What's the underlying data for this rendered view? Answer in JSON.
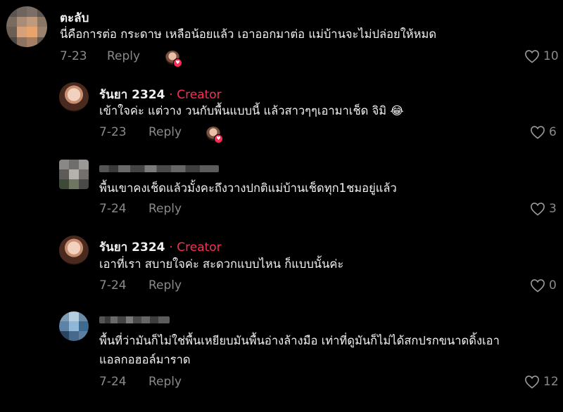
{
  "comments": [
    {
      "username": "ตะลับ",
      "text": "นี่คือการต่อ กระดาษ เหลือน้อยแล้ว เอาออกมาต่อ แม่บ้านจะไม่ปล่อยให้หมด",
      "date": "7-23",
      "reply_label": "Reply",
      "likes": "10",
      "creator_liked": true
    },
    {
      "username": "รันยา 2324",
      "creator_label": "· Creator",
      "text": "เข้าใจค่ะ แต่วาง วนกับพื้นแบบนี้ แล้วสาวๆๆเอามาเช็ด จิมิ 😂",
      "date": "7-23",
      "reply_label": "Reply",
      "likes": "6",
      "creator_liked": true
    },
    {
      "text": "พื้นเขาคงเช็ดแล้วมั้งคะถึงวางปกติแม่บ้านเช็ดทุก1ชมอยู่แล้ว",
      "date": "7-24",
      "reply_label": "Reply",
      "likes": "3"
    },
    {
      "username": "รันยา 2324",
      "creator_label": "· Creator",
      "text": "เอาที่เรา สบายใจค่ะ สะดวกแบบไหน ก็แบบนั้นค่ะ",
      "date": "7-24",
      "reply_label": "Reply",
      "likes": "0"
    },
    {
      "text_line1": "พื้นที่ว่ามันก็ไม่ใช่พื้นเหยียบมันพื้นอ่างล้างมือ เท่าที่ดูมันก็ไม่ได้สกปรกขนาดดิ้งเอา",
      "text_line2": "แอลกอฮอล์มาราด",
      "date": "7-24",
      "reply_label": "Reply",
      "likes": "12"
    }
  ],
  "icons": {
    "like": "heart-outline-icon",
    "creator_like": "creator-liked-avatar-icon"
  },
  "colors": {
    "background": "#000000",
    "creator": "#fe2c55",
    "meta": "#8a8a8a"
  }
}
